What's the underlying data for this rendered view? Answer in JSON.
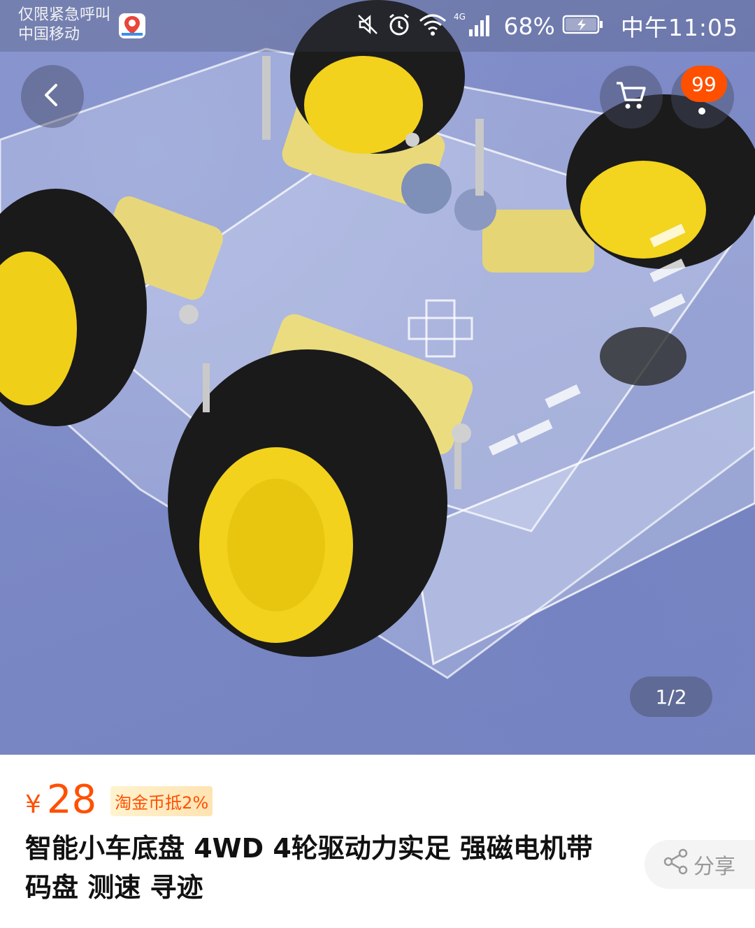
{
  "status_bar": {
    "carrier_line1": "仅限紧急呼叫",
    "carrier_line2": "中国移动",
    "network": "4G",
    "battery_percent": "68%",
    "time": "中午11:05",
    "icons": [
      "mute-icon",
      "alarm-icon",
      "wifi-icon",
      "signal-icon",
      "battery-icon",
      "map-app-icon"
    ]
  },
  "header": {
    "cart_badge": "99"
  },
  "gallery": {
    "pager": "1/2"
  },
  "product": {
    "currency": "¥",
    "price": "28",
    "coin_tag": "淘金币抵2%",
    "title": "智能小车底盘 4WD 4轮驱动力实足 强磁电机带码盘 测速 寻迹",
    "share_label": "分享"
  },
  "colors": {
    "accent": "#ff5000",
    "title_text": "#111111",
    "share_text": "#999999",
    "image_background": "#7c89c6"
  }
}
